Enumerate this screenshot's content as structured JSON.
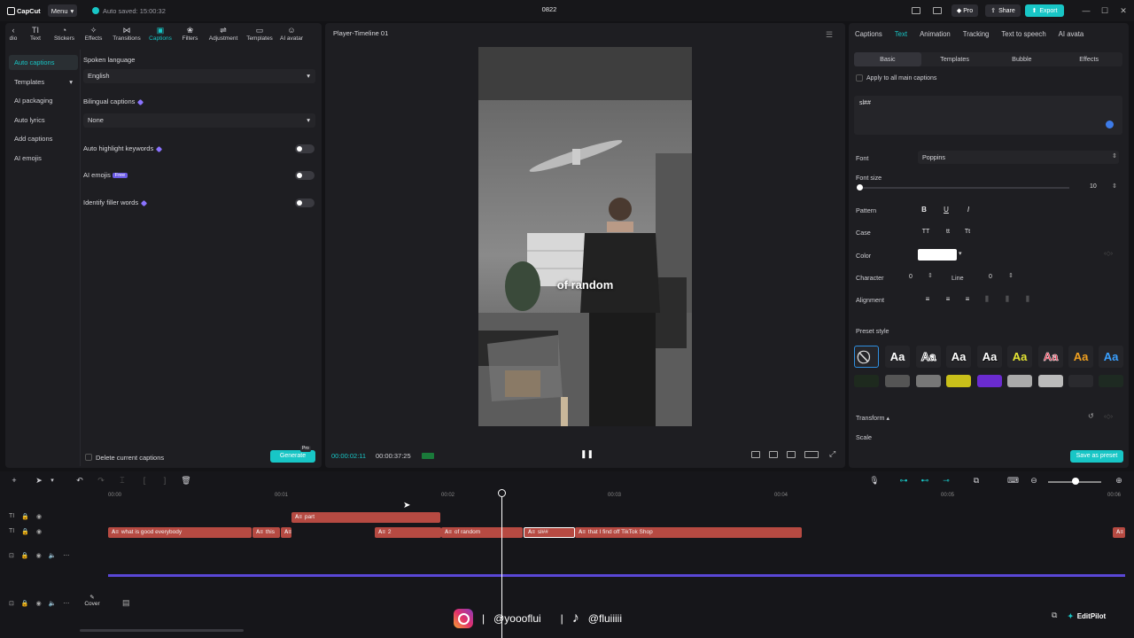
{
  "titlebar": {
    "app": "CapCut",
    "menu_label": "Menu",
    "autosave": "Auto saved: 15:00:32",
    "project": "0822",
    "pro_label": "Pro",
    "share_label": "Share",
    "export_label": "Export"
  },
  "toolbar": {
    "items": [
      {
        "label": "dio",
        "icon": "audio-icon"
      },
      {
        "label": "Text",
        "icon": "text-icon"
      },
      {
        "label": "Stickers",
        "icon": "sticker-icon"
      },
      {
        "label": "Effects",
        "icon": "effects-icon"
      },
      {
        "label": "Transitions",
        "icon": "transition-icon"
      },
      {
        "label": "Captions",
        "icon": "captions-icon",
        "active": true
      },
      {
        "label": "Filters",
        "icon": "filter-icon"
      },
      {
        "label": "Adjustment",
        "icon": "adjustment-icon"
      },
      {
        "label": "Templates",
        "icon": "template-icon"
      },
      {
        "label": "AI avatar",
        "icon": "avatar-icon"
      }
    ]
  },
  "captions_nav": [
    {
      "label": "Auto captions",
      "active": true
    },
    {
      "label": "Templates",
      "dropdown": true
    },
    {
      "label": "AI packaging"
    },
    {
      "label": "Auto lyrics"
    },
    {
      "label": "Add captions"
    },
    {
      "label": "AI emojis"
    }
  ],
  "auto_captions": {
    "spoken_language_label": "Spoken language",
    "spoken_language_value": "English",
    "bilingual_label": "Bilingual captions",
    "bilingual_value": "None",
    "highlight_label": "Auto highlight keywords",
    "emojis_label": "AI emojis",
    "free_badge": "Free",
    "filler_label": "Identify filler words",
    "delete_label": "Delete current captions",
    "generate_label": "Generate",
    "pro_tag": "Pro"
  },
  "player": {
    "title": "Player-Timeline 01",
    "caption_text": "of random",
    "timecode_current": "00:00:02:11",
    "timecode_total": "00:00:37:25"
  },
  "right_panel": {
    "tabs": [
      {
        "label": "Captions"
      },
      {
        "label": "Text",
        "active": true
      },
      {
        "label": "Animation"
      },
      {
        "label": "Tracking"
      },
      {
        "label": "Text to speech"
      },
      {
        "label": "AI avata"
      }
    ],
    "subtabs": [
      {
        "label": "Basic",
        "active": true
      },
      {
        "label": "Templates"
      },
      {
        "label": "Bubble"
      },
      {
        "label": "Effects"
      }
    ],
    "apply_all_label": "Apply to all main captions",
    "text_value": "sl##",
    "font_label": "Font",
    "font_value": "Poppins",
    "font_size_label": "Font size",
    "font_size_value": "10",
    "pattern_label": "Pattern",
    "case_label": "Case",
    "color_label": "Color",
    "color_value": "#ffffff",
    "character_label": "Character",
    "character_value": "0",
    "line_label": "Line",
    "line_value": "0",
    "alignment_label": "Alignment",
    "preset_label": "Preset style",
    "preset_text": "Aa",
    "transform_label": "Transform",
    "scale_label": "Scale",
    "save_preset_label": "Save as preset"
  },
  "timeline": {
    "ruler": [
      "00:00",
      "00:01",
      "00:02",
      "00:03",
      "00:04",
      "00:05",
      "00:06"
    ],
    "clips_row1": [
      {
        "label": "part"
      }
    ],
    "clips_row2": [
      {
        "label": "what is good everybody"
      },
      {
        "label": "this"
      },
      {
        "label": ""
      },
      {
        "label": "2"
      },
      {
        "label": "of random"
      },
      {
        "label": "sl##",
        "selected": true
      },
      {
        "label": "that I find off TikTok Shop"
      },
      {
        "label": ""
      }
    ],
    "cover_label": "Cover"
  },
  "overlay": {
    "instagram": "@yooofluі",
    "tiktok": "@fluiiiii",
    "sep": "|",
    "editpilot": "EditPilot"
  },
  "colors": {
    "accent": "#18c6c6",
    "clip": "#b64a42",
    "video_track": "#5a47d6"
  }
}
